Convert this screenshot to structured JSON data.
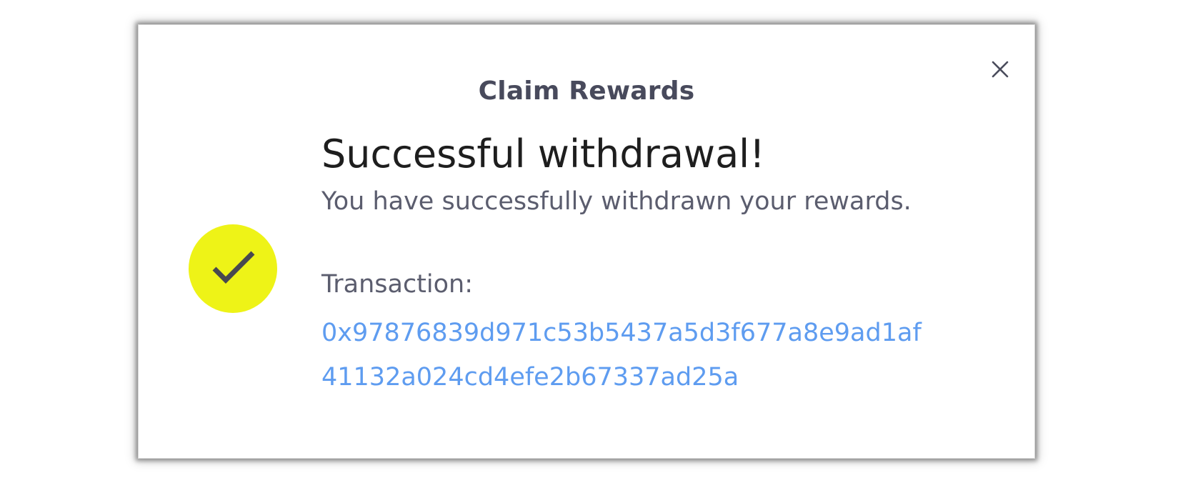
{
  "modal": {
    "title": "Claim Rewards",
    "close_icon": "close-icon"
  },
  "status": {
    "icon": "checkmark-icon",
    "icon_bg_color": "#eef317",
    "heading": "Successful withdrawal!",
    "message": "You have successfully withdrawn your rewards."
  },
  "transaction": {
    "label": "Transaction:",
    "hash_line1": "0x97876839d971c53b5437a5d3f677a8e9ad1af",
    "hash_line2": "41132a024cd4efe2b67337ad25a",
    "link_color": "#5e9cf0"
  }
}
